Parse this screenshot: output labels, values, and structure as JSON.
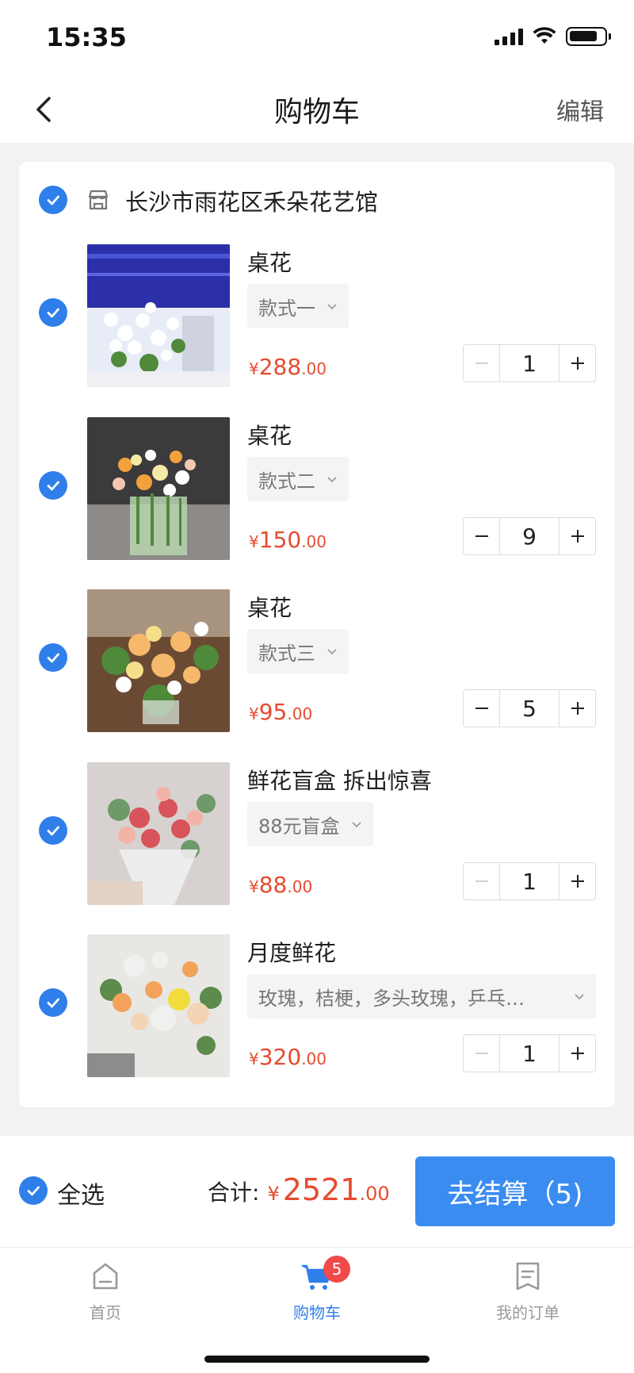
{
  "status": {
    "time": "15:35"
  },
  "nav": {
    "title": "购物车",
    "edit_label": "编辑"
  },
  "shop": {
    "name": "长沙市雨花区禾朵花艺馆"
  },
  "items": [
    {
      "title": "桌花",
      "spec": "款式一",
      "price_cur": "¥",
      "price_int": "288",
      "price_dec": ".00",
      "qty": "1"
    },
    {
      "title": "桌花",
      "spec": "款式二",
      "price_cur": "¥",
      "price_int": "150",
      "price_dec": ".00",
      "qty": "9"
    },
    {
      "title": "桌花",
      "spec": "款式三",
      "price_cur": "¥",
      "price_int": "95",
      "price_dec": ".00",
      "qty": "5"
    },
    {
      "title": "鲜花盲盒 拆出惊喜",
      "spec": "88元盲盒",
      "price_cur": "¥",
      "price_int": "88",
      "price_dec": ".00",
      "qty": "1"
    },
    {
      "title": "月度鲜花",
      "spec": "玫瑰，桔梗，多头玫瑰，乒乓…",
      "price_cur": "¥",
      "price_int": "320",
      "price_dec": ".00",
      "qty": "1"
    }
  ],
  "summary": {
    "select_all_label": "全选",
    "total_label": "合计:",
    "total_cur": "¥",
    "total_int": "2521",
    "total_dec": ".00",
    "checkout_label": "去结算（5)"
  },
  "tabs": [
    {
      "label": "首页",
      "icon": "home-icon"
    },
    {
      "label": "购物车",
      "icon": "cart-icon",
      "badge": "5"
    },
    {
      "label": "我的订单",
      "icon": "orders-icon"
    }
  ],
  "colors": {
    "accent": "#2f7fea",
    "price": "#e64b2e",
    "checkout": "#3a8cf0",
    "badge": "#f04a4a"
  }
}
